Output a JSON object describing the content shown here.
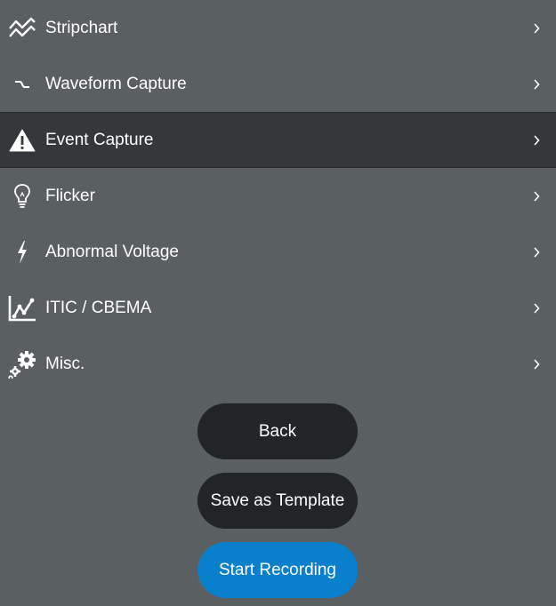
{
  "menu": {
    "items": [
      {
        "label": "Stripchart",
        "icon": "stripchart-icon"
      },
      {
        "label": "Waveform Capture",
        "icon": "waveform-icon"
      },
      {
        "label": "Event Capture",
        "icon": "warning-icon",
        "selected": true
      },
      {
        "label": "Flicker",
        "icon": "lightbulb-icon"
      },
      {
        "label": "Abnormal Voltage",
        "icon": "lightning-icon"
      },
      {
        "label": "ITIC / CBEMA",
        "icon": "line-chart-icon"
      },
      {
        "label": "Misc.",
        "icon": "gears-icon"
      }
    ]
  },
  "buttons": {
    "back": "Back",
    "save_template": "Save as Template",
    "start_recording": "Start Recording"
  },
  "colors": {
    "background": "#5a5f61",
    "selected_row": "#34383a",
    "button_dark": "#222527",
    "button_primary": "#0a80cc",
    "text": "#ffffff"
  }
}
